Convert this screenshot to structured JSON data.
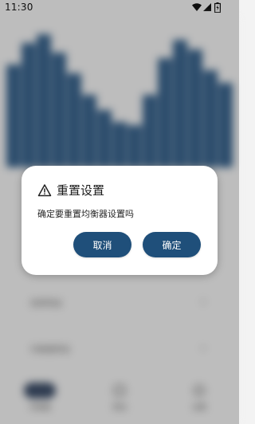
{
  "status_bar": {
    "time": "11:30",
    "icons": [
      "wifi-icon",
      "signal-icon",
      "battery-icon"
    ]
  },
  "background": {
    "equalizer_levels": [
      0.68,
      0.82,
      0.88,
      0.76,
      0.62,
      0.48,
      0.38,
      0.3,
      0.28,
      0.48,
      0.72,
      0.84,
      0.78,
      0.64,
      0.56
    ],
    "settings_rows": [
      "低频增益",
      "均衡器预设"
    ],
    "nav": [
      "均衡器",
      "预设",
      "设置"
    ]
  },
  "dialog": {
    "title": "重置设置",
    "title_icon": "warning-icon",
    "message": "确定要重置均衡器设置吗",
    "cancel_label": "取消",
    "confirm_label": "确定"
  },
  "colors": {
    "accent": "#1f4f7a",
    "dialog_bg": "#ffffff"
  }
}
